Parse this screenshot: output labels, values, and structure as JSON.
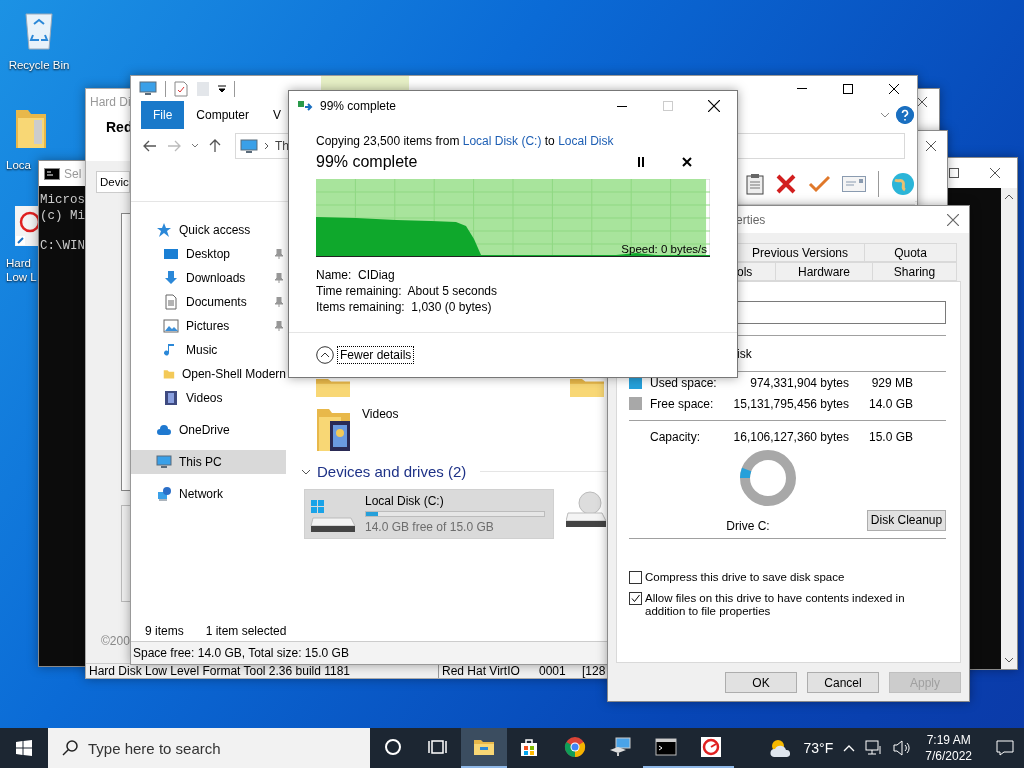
{
  "desktop_icons": [
    {
      "label": "Recycle Bin",
      "kind": "recycle-bin"
    },
    {
      "label": "Loca",
      "kind": "folder"
    },
    {
      "label": "Hard Low L",
      "kind": "disk-tool"
    }
  ],
  "console_left": {
    "title": "Sel",
    "lines": [
      "Micros",
      "(c) Mi",
      "C:\\WIN"
    ]
  },
  "format_tool": {
    "title": "Hard Di",
    "heading": "Red",
    "tab": "Devic",
    "copyright": "©200",
    "status_bar": [
      "Hard Disk Low Level Format Tool 2.36 build 1181",
      "Red Hat VirtIO",
      "0001",
      "[128"
    ]
  },
  "explorer": {
    "ribbon_tabs": [
      {
        "label": "File",
        "selected": true
      },
      {
        "label": "Computer",
        "selected": false
      },
      {
        "label": "V",
        "selected": false
      }
    ],
    "address": "Th",
    "nav": [
      {
        "label": "Quick access",
        "kind": "star",
        "selected": false,
        "children": [
          {
            "label": "Desktop",
            "kind": "desktop",
            "pinned": true,
            "selected": false
          },
          {
            "label": "Downloads",
            "kind": "download",
            "pinned": true,
            "selected": false
          },
          {
            "label": "Documents",
            "kind": "document",
            "pinned": true,
            "selected": false
          },
          {
            "label": "Pictures",
            "kind": "pictures",
            "pinned": true,
            "selected": false
          },
          {
            "label": "Music",
            "kind": "music",
            "pinned": false,
            "selected": false
          },
          {
            "label": "Open-Shell Modern",
            "kind": "folder",
            "pinned": false,
            "selected": false
          },
          {
            "label": "Videos",
            "kind": "video",
            "pinned": false,
            "selected": false
          }
        ]
      },
      {
        "label": "OneDrive",
        "kind": "cloud",
        "selected": false
      },
      {
        "label": "This PC",
        "kind": "pc",
        "selected": true
      },
      {
        "label": "Network",
        "kind": "network",
        "selected": false
      }
    ],
    "folders": [
      {
        "label": "Videos"
      }
    ],
    "group": "Devices and drives (2)",
    "drives": [
      {
        "name": "Local Disk (C:)",
        "level": 0.07,
        "free": "14.0 GB free of 15.0 GB",
        "selected": true
      }
    ],
    "status": [
      "9 items",
      "1 item selected"
    ],
    "details_bar": "Space free: 14.0 GB, Total size: 15.0 GB"
  },
  "properties": {
    "title": "erties",
    "tabs": [
      [
        {
          "label": "Previous Versions",
          "selected": false
        },
        {
          "label": "Quota",
          "selected": false
        }
      ],
      [
        {
          "label": "ols",
          "selected": false
        },
        {
          "label": "Hardware",
          "selected": false
        },
        {
          "label": "Sharing",
          "selected": false
        }
      ]
    ],
    "type_text": "isk",
    "space": [
      {
        "label": "Used space:",
        "bytes": "974,331,904 bytes",
        "size": "929 MB",
        "color": "#26a0da"
      },
      {
        "label": "Free space:",
        "bytes": "15,131,795,456 bytes",
        "size": "14.0 GB",
        "color": "#a8a8a8"
      }
    ],
    "capacity": {
      "label": "Capacity:",
      "bytes": "16,106,127,360 bytes",
      "size": "15.0 GB"
    },
    "usage": {
      "level": 0.06
    },
    "drive_label": "Drive C:",
    "cleanup_button": "Disk Cleanup",
    "options": [
      {
        "label": "Compress this drive to save disk space",
        "checked": false
      },
      {
        "label": "Allow files on this drive to have contents indexed in addition to file properties",
        "checked": true
      }
    ],
    "buttons": [
      {
        "label": "OK",
        "disabled": false
      },
      {
        "label": "Cancel",
        "disabled": false
      },
      {
        "label": "Apply",
        "disabled": true
      }
    ]
  },
  "copy_dialog": {
    "title": "99% complete",
    "summary": {
      "prefix": "Copying 23,500 items from ",
      "source": "Local Disk (C:)",
      "middle": " to ",
      "target": "Local Disk"
    },
    "heading": "99% complete",
    "level": 0.99,
    "speed": "Speed: 0 bytes/s",
    "details": [
      "Name:  CIDiag",
      "Time remaining:  About 5 seconds",
      "Items remaining:  1,030 (0 bytes)"
    ],
    "toggle": "Fewer details"
  },
  "taskbar": {
    "search_placeholder": "Type here to search",
    "apps": [
      {
        "kind": "cortana",
        "running": false,
        "selected": false
      },
      {
        "kind": "task-view",
        "running": false,
        "selected": false
      },
      {
        "kind": "explorer",
        "running": true,
        "selected": true
      },
      {
        "kind": "store",
        "running": false,
        "selected": false
      },
      {
        "kind": "chrome",
        "running": false,
        "selected": false
      },
      {
        "kind": "remote",
        "running": false,
        "selected": false
      },
      {
        "kind": "console",
        "running": true,
        "selected": false
      },
      {
        "kind": "disk-tool",
        "running": true,
        "selected": false
      }
    ],
    "weather": "73°F",
    "time": "7:19 AM",
    "date": "7/6/2022"
  }
}
